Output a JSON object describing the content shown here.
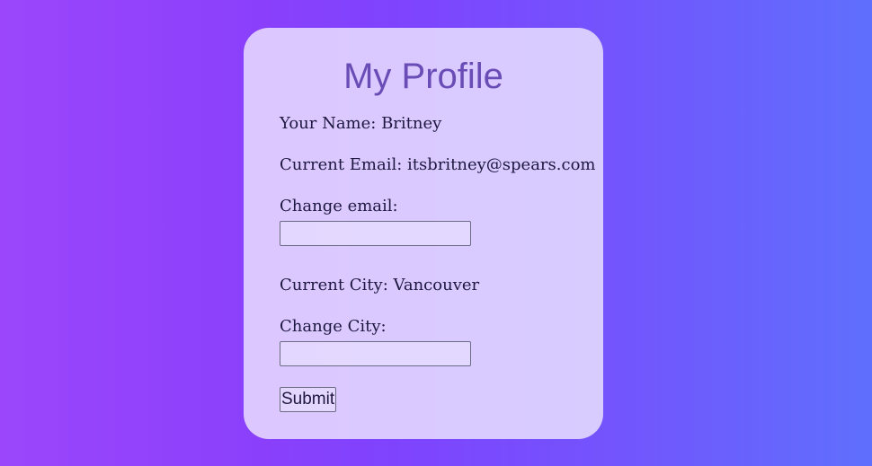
{
  "profile": {
    "title": "My Profile",
    "name_label": "Your Name:",
    "name_value": "Britney",
    "email_label": "Current Email:",
    "email_value": "itsbritney@spears.com",
    "change_email_label": "Change email:",
    "change_email_value": "",
    "city_label": "Current City:",
    "city_value": "Vancouver",
    "change_city_label": "Change City:",
    "change_city_value": "",
    "submit_label": "Submit"
  },
  "colors": {
    "title": "#6a4cb6",
    "text": "#1e1840",
    "gradient_start": "#9b46fb",
    "gradient_end": "#5f6ffd"
  }
}
